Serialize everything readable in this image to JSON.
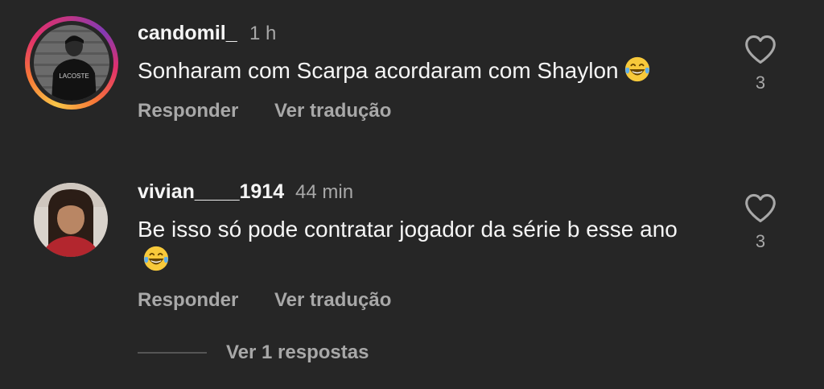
{
  "comments": [
    {
      "username": "candomil_",
      "time": "1 h",
      "text": "Sonharam com Scarpa acordaram com Shaylon",
      "emoji": "tears-of-joy-emoji",
      "reply_label": "Responder",
      "translate_label": "Ver tradução",
      "like_count": "3",
      "avatar_caption": "LACOSTE",
      "has_story_ring": true
    },
    {
      "username": "vivian____1914",
      "time": "44 min",
      "text": "Be isso só pode contratar jogador da série b esse ano",
      "emoji": "tears-of-joy-emoji",
      "reply_label": "Responder",
      "translate_label": "Ver tradução",
      "like_count": "3",
      "has_story_ring": false
    }
  ],
  "view_replies_label": "Ver 1 respostas",
  "colors": {
    "background": "#262626",
    "primary_text": "#f5f5f5",
    "secondary_text": "#a8a8a8"
  }
}
